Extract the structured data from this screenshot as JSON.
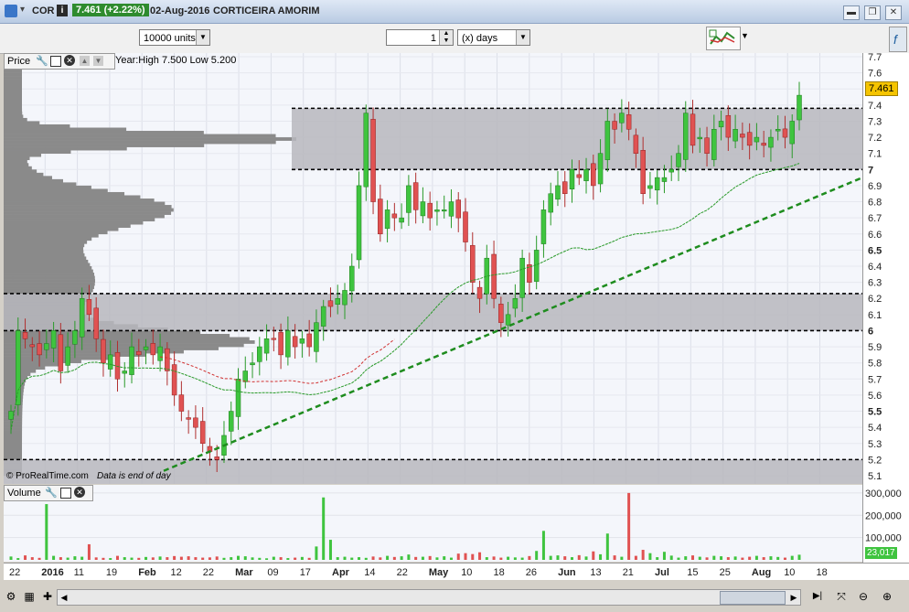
{
  "window": {
    "symbol": "COR",
    "info_badge": "i",
    "price_change": "7.461 (+2.22%)",
    "date": "02-Aug-2016",
    "company": "CORTICEIRA AMORIM"
  },
  "toolbar": {
    "units_select": "10000 units",
    "period_value": "1",
    "period_unit_select": "(x) days"
  },
  "price_panel": {
    "label": "Price",
    "year_range": "Year:High 7.500 Low 5.200",
    "copyright": "© ProRealTime.com",
    "end_note": "Data is end of day",
    "last_price_label": "7.461"
  },
  "volume_panel": {
    "label": "Volume",
    "last_volume_label": "23,017"
  },
  "colors": {
    "up": "#3fc43f",
    "down": "#e05252",
    "zone": "#b7b7bd",
    "trend": "#1e8c1e",
    "badge": "#f5c400"
  },
  "chart_data": [
    {
      "type": "candlestick",
      "title": "",
      "ylim": [
        5.1,
        7.7
      ],
      "y_ticks": [
        "7.7",
        "7.6",
        "7.5",
        "7.4",
        "7.3",
        "7.2",
        "7.1",
        "7",
        "6.9",
        "6.8",
        "6.7",
        "6.6",
        "6.5",
        "6.4",
        "6.3",
        "6.2",
        "6.1",
        "6",
        "5.9",
        "5.8",
        "5.7",
        "5.6",
        "5.5",
        "5.4",
        "5.3",
        "5.2",
        "5.1"
      ],
      "x_ticks": [
        "22",
        "2016",
        "11",
        "19",
        "Feb",
        "12",
        "22",
        "Mar",
        "09",
        "17",
        "Apr",
        "14",
        "22",
        "May",
        "10",
        "18",
        "26",
        "Jun",
        "13",
        "21",
        "Jul",
        "15",
        "25",
        "Aug",
        "10",
        "18"
      ],
      "resistance_zones": [
        [
          7.0,
          7.38
        ],
        [
          6.0,
          6.23
        ]
      ],
      "support_level": 5.2,
      "trendline": {
        "from": [
          "Feb 12",
          5.13
        ],
        "to": [
          "Aug 18",
          6.95
        ]
      },
      "last_close": 7.461,
      "closes": [
        5.5,
        6.0,
        5.95,
        5.9,
        5.85,
        5.92,
        6.0,
        5.75,
        5.9,
        6.0,
        6.2,
        6.1,
        5.95,
        5.8,
        5.85,
        5.7,
        5.75,
        5.9,
        5.85,
        5.9,
        5.85,
        5.9,
        5.75,
        5.6,
        5.5,
        5.45,
        5.4,
        5.3,
        5.25,
        5.2,
        5.35,
        5.5,
        5.7,
        5.75,
        5.8,
        5.9,
        5.95,
        5.95,
        5.85,
        6.0,
        5.9,
        5.95,
        5.9,
        6.05,
        6.15,
        6.15,
        6.2,
        6.25,
        6.4,
        6.9,
        7.35,
        6.8,
        6.6,
        6.75,
        6.7,
        6.7,
        6.9,
        6.75,
        6.8,
        6.7,
        6.75,
        6.75,
        6.8,
        6.7,
        6.55,
        6.3,
        6.2,
        6.45,
        6.2,
        6.05,
        6.1,
        6.2,
        6.45,
        6.3,
        6.5,
        6.75,
        6.85,
        6.9,
        6.85,
        7.0,
        6.95,
        7.0,
        6.9,
        7.1,
        7.3,
        7.25,
        7.35,
        7.25,
        7.1,
        6.85,
        6.9,
        6.95,
        6.95,
        7.0,
        7.1,
        7.35,
        7.15,
        7.2,
        7.1,
        7.25,
        7.3,
        7.2,
        7.25,
        7.2,
        7.15,
        7.2,
        7.15,
        7.2,
        7.25,
        7.2,
        7.3,
        7.461
      ]
    },
    {
      "type": "bar",
      "title": "",
      "y_ticks": [
        "300,000",
        "200,000",
        "100,000"
      ],
      "ylim": [
        0,
        320000
      ],
      "last_value": 23017,
      "values": [
        15000,
        8000,
        20000,
        12000,
        9000,
        250000,
        18000,
        12000,
        10000,
        16000,
        14000,
        70000,
        11000,
        9000,
        8000,
        18000,
        12000,
        10000,
        9000,
        13000,
        11000,
        15000,
        12000,
        17000,
        14000,
        16000,
        12000,
        10000,
        11000,
        15000,
        9000,
        12000,
        18000,
        16000,
        11000,
        9000,
        7000,
        14000,
        12000,
        8000,
        10000,
        13000,
        9000,
        60000,
        280000,
        90000,
        12000,
        14000,
        10000,
        12000,
        9000,
        15000,
        11000,
        18000,
        13000,
        16000,
        24000,
        13000,
        14000,
        17000,
        11000,
        16000,
        10000,
        28000,
        30000,
        26000,
        34000,
        12000,
        15000,
        10000,
        14000,
        11000,
        10000,
        17000,
        40000,
        130000,
        18000,
        20000,
        16000,
        12000,
        21000,
        15000,
        38000,
        25000,
        118000,
        20000,
        14000,
        300000,
        18000,
        45000,
        30000,
        12000,
        36000,
        19000,
        10000,
        16000,
        20000,
        14000,
        11000,
        18000,
        16000,
        12000,
        15000,
        10000,
        14000,
        18000,
        12000,
        16000,
        13000,
        10000,
        18000,
        23017
      ]
    }
  ]
}
